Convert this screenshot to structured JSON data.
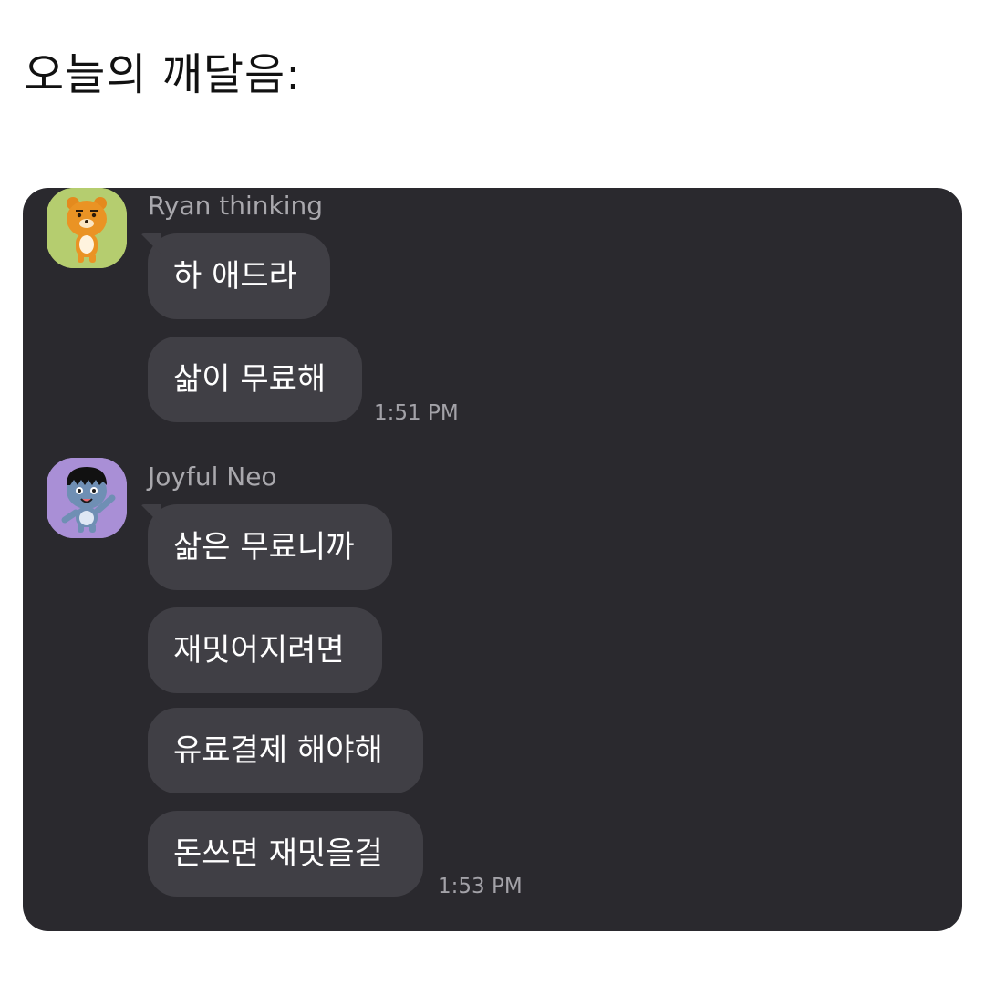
{
  "caption": "오늘의 깨달음:",
  "chat": {
    "groups": [
      {
        "sender": "Ryan thinking",
        "avatar_icon": "ryan-character-icon",
        "avatar_bg": "#b5cd6f",
        "messages": [
          "하 애드라",
          "삶이 무료해"
        ],
        "time": "1:51 PM"
      },
      {
        "sender": "Joyful Neo",
        "avatar_icon": "neo-character-icon",
        "avatar_bg": "#a98fd6",
        "messages": [
          "삶은 무료니까",
          "재밋어지려면",
          "유료결제 해야해",
          "돈쓰면 재밋을걸"
        ],
        "time": "1:53 PM"
      }
    ]
  },
  "colors": {
    "chat_bg": "#2a292e",
    "bubble_bg": "#403f45",
    "bubble_text": "#ffffff",
    "meta_text": "#a9a8ad"
  }
}
